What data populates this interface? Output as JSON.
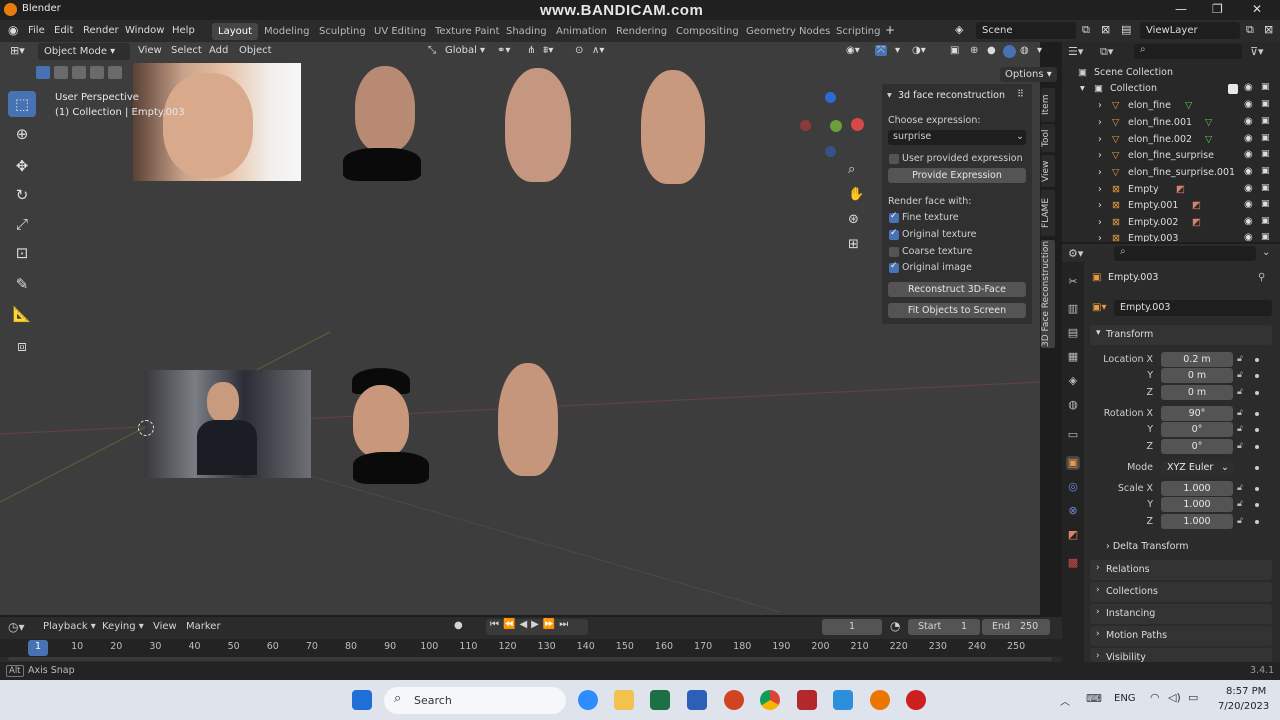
{
  "window": {
    "title": "Blender",
    "watermark": "www.BANDICAM.com"
  },
  "menu": [
    "File",
    "Edit",
    "Render",
    "Window",
    "Help"
  ],
  "workspaces": [
    "Layout",
    "Modeling",
    "Sculpting",
    "UV Editing",
    "Texture Paint",
    "Shading",
    "Animation",
    "Rendering",
    "Compositing",
    "Geometry Nodes",
    "Scripting"
  ],
  "active_workspace": "Layout",
  "scene": {
    "name": "Scene",
    "view_layer": "ViewLayer"
  },
  "viewport_header": {
    "mode": "Object Mode",
    "view": "View",
    "select": "Select",
    "add": "Add",
    "object": "Object",
    "orientation": "Global",
    "options": "Options"
  },
  "overlay": {
    "perspective": "User Perspective",
    "collection": "(1) Collection | Empty.003"
  },
  "npanel": {
    "title": "3d face reconstruction",
    "choose_expression_label": "Choose expression:",
    "expression": "surprise",
    "user_provided_label": "User provided expression",
    "provide_button": "Provide Expression",
    "render_with_label": "Render face with:",
    "options": [
      {
        "label": "Fine texture",
        "checked": true
      },
      {
        "label": "Original texture",
        "checked": true
      },
      {
        "label": "Coarse texture",
        "checked": false
      },
      {
        "label": "Original image",
        "checked": true
      }
    ],
    "reconstruct_button": "Reconstruct 3D-Face",
    "fit_button": "Fit Objects to Screen"
  },
  "side_tabs": [
    "Item",
    "Tool",
    "View",
    "FLAME",
    "3D Face Reconstruction"
  ],
  "outliner": {
    "scene_collection": "Scene Collection",
    "collection": "Collection",
    "items": [
      "elon_fine",
      "elon_fine.001",
      "elon_fine.002",
      "elon_fine_surprise",
      "elon_fine_surprise.001",
      "Empty",
      "Empty.001",
      "Empty.002",
      "Empty.003"
    ]
  },
  "properties": {
    "object_name": "Empty.003",
    "data_name": "Empty.003",
    "transform_label": "Transform",
    "location_label": "Location X",
    "location": [
      "0.2 m",
      "0 m",
      "0 m"
    ],
    "rotation_label": "Rotation X",
    "rotation": [
      "90°",
      "0°",
      "0°"
    ],
    "mode_label": "Mode",
    "mode": "XYZ Euler",
    "scale_label": "Scale X",
    "scale": [
      "1.000",
      "1.000",
      "1.000"
    ],
    "axis_y": "Y",
    "axis_z": "Z",
    "delta": "Delta Transform",
    "panels": [
      "Relations",
      "Collections",
      "Instancing",
      "Motion Paths",
      "Visibility"
    ]
  },
  "timeline": {
    "playback": "Playback",
    "keying": "Keying",
    "view": "View",
    "marker": "Marker",
    "current_frame": "1",
    "start_label": "Start",
    "start": "1",
    "end_label": "End",
    "end": "250",
    "ticks": [
      "1",
      "10",
      "20",
      "30",
      "40",
      "50",
      "60",
      "70",
      "80",
      "90",
      "100",
      "110",
      "120",
      "130",
      "140",
      "150",
      "160",
      "170",
      "180",
      "190",
      "200",
      "210",
      "220",
      "230",
      "240",
      "250"
    ]
  },
  "status": {
    "key": "Alt",
    "hint": "Axis Snap",
    "version": "3.4.1"
  },
  "taskbar": {
    "search": "Search",
    "lang": "ENG",
    "time": "8:57 PM",
    "date": "7/20/2023"
  }
}
